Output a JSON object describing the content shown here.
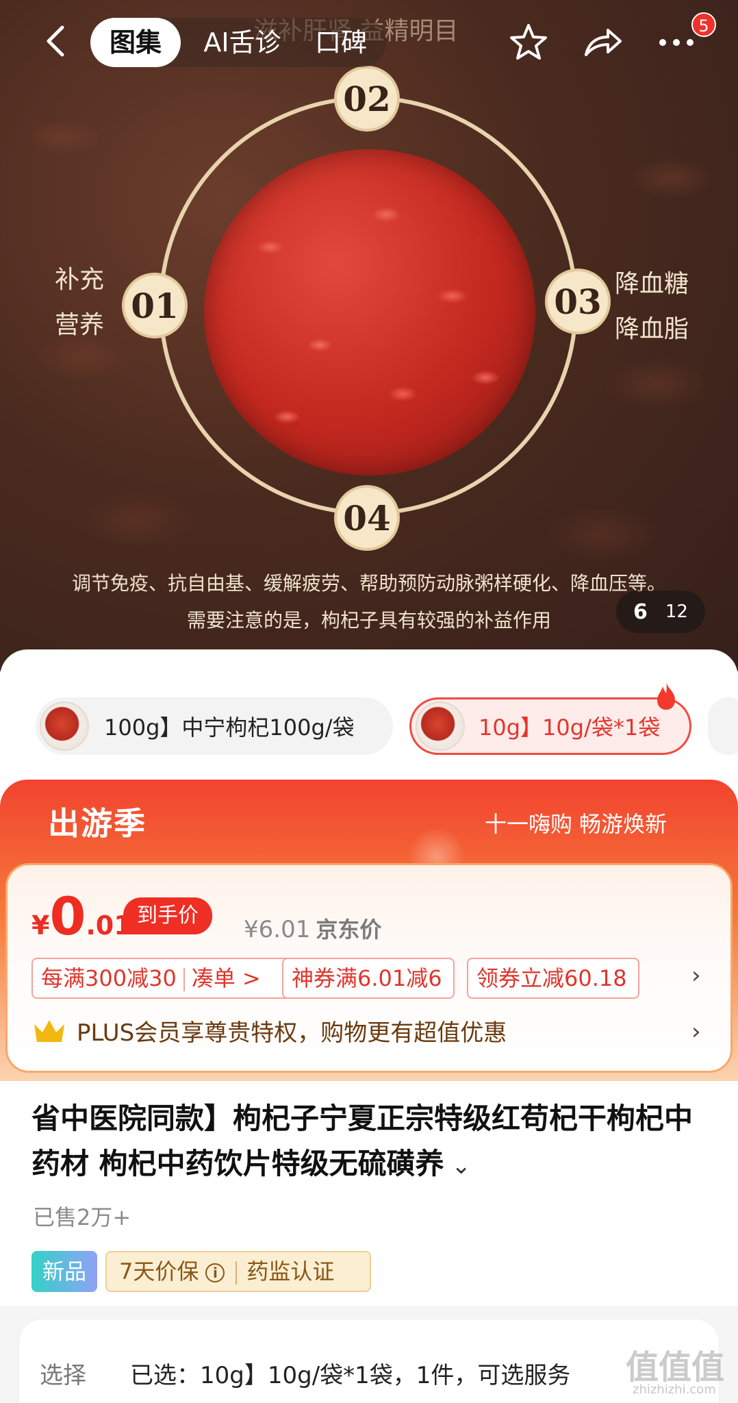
{
  "hero": {
    "banner_text": "滋补肝肾 益精明目",
    "badges": [
      "01",
      "02",
      "03",
      "04"
    ],
    "left_label": [
      "补充",
      "营养"
    ],
    "right_label": [
      "降血糖",
      "降血脂"
    ],
    "caption_line1": "调节免疫、抗自由基、缓解疲劳、帮助预防动脉粥样硬化、降血压等。",
    "caption_line2": "需要注意的是，枸杞子具有较强的补益作用",
    "counter_current": "6",
    "counter_total": "12"
  },
  "nav": {
    "tabs": [
      {
        "label": "图集",
        "active": true
      },
      {
        "label": "AI舌诊",
        "active": false
      },
      {
        "label": "口碑",
        "active": false
      }
    ],
    "notification_count": "5"
  },
  "variants": [
    {
      "label": "100g】中宁枸杞100g/袋",
      "selected": false
    },
    {
      "label": "10g】10g/袋*1袋",
      "selected": true
    }
  ],
  "promo": {
    "title": "出游季",
    "slogan": "十一嗨购 畅游焕新"
  },
  "price": {
    "symbol": "¥",
    "integer": "0",
    "decimal": ".01",
    "final_label": "到手价",
    "jd_price": "¥6.01",
    "jd_label": "京东价",
    "coupons": {
      "c1_main": "每满300减30",
      "c1_action": "凑单 >",
      "c2": "神券满6.01减6",
      "c3": "领券立减60.18"
    },
    "plus_text": "PLUS会员享尊贵特权，购物更有超值优惠"
  },
  "product": {
    "title": "省中医院同款】枸杞子宁夏正宗特级红苟杞干枸杞中药材 枸杞中药饮片特级无硫磺养",
    "sold": "已售2万+",
    "tag_new": "新品",
    "tag_price_guard": "7天价保",
    "tag_cert": "药监认证"
  },
  "selection": {
    "label": "选择",
    "value": "已选：10g】10g/袋*1袋，1件，可选服务"
  },
  "watermark": {
    "main": "值值值",
    "sub": "zhizhizhi.com"
  },
  "colors": {
    "accent_red": "#ee2c22",
    "promo_orange": "#f57a3b",
    "hero_brown": "#4a2a1f"
  }
}
